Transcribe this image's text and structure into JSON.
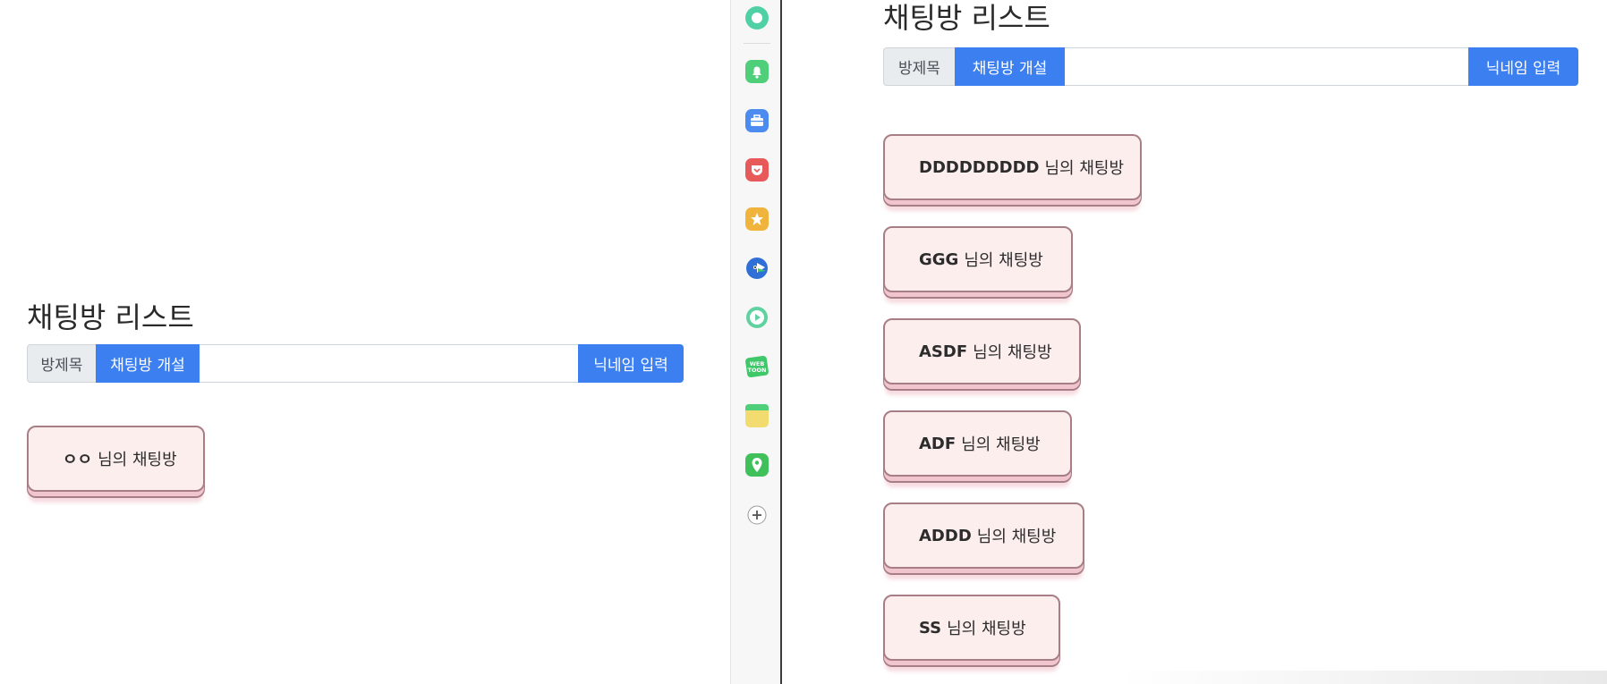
{
  "left": {
    "title": "채팅방 리스트",
    "label": "방제목",
    "create_button": "채팅방 개설",
    "input_value": "",
    "nickname_button": "닉네임 입력",
    "rooms": [
      {
        "name": "ㅇㅇ",
        "suffix": "님의 채팅방"
      }
    ]
  },
  "right": {
    "title": "채팅방 리스트",
    "label": "방제목",
    "create_button": "채팅방 개설",
    "input_value": "",
    "nickname_button": "닉네임 입력",
    "rooms": [
      {
        "name": "DDDDDDDDD",
        "suffix": "님의 채팅방"
      },
      {
        "name": "GGG",
        "suffix": "님의 채팅방"
      },
      {
        "name": "ASDF",
        "suffix": "님의 채팅방"
      },
      {
        "name": "ADF",
        "suffix": "님의 채팅방"
      },
      {
        "name": "ADDD",
        "suffix": "님의 채팅방"
      },
      {
        "name": "SS",
        "suffix": "님의 채팅방"
      }
    ]
  },
  "sidebar": {
    "icons": [
      {
        "name": "green-circle-icon",
        "color": "#4fd1a5"
      },
      {
        "name": "bell-icon",
        "color": "#4fcf7a"
      },
      {
        "name": "briefcase-icon",
        "color": "#4c8cf0"
      },
      {
        "name": "pocket-icon",
        "color": "#e85a5a"
      },
      {
        "name": "star-icon",
        "color": "#f0b43c"
      },
      {
        "name": "bird-icon",
        "color": "#2f6fd6"
      },
      {
        "name": "play-icon",
        "color": "#5fd2a0"
      },
      {
        "name": "webtoon-icon",
        "color": "#3fc86a",
        "text": "WEB TOON"
      },
      {
        "name": "note-icon",
        "color": "#f2dc6f"
      },
      {
        "name": "map-pin-icon",
        "color": "#3fc05a"
      },
      {
        "name": "add-icon",
        "color": "#555555"
      }
    ]
  },
  "colors": {
    "accent": "#3b7ff0",
    "room_bg": "#fdeeee",
    "room_border": "#a77e86"
  }
}
